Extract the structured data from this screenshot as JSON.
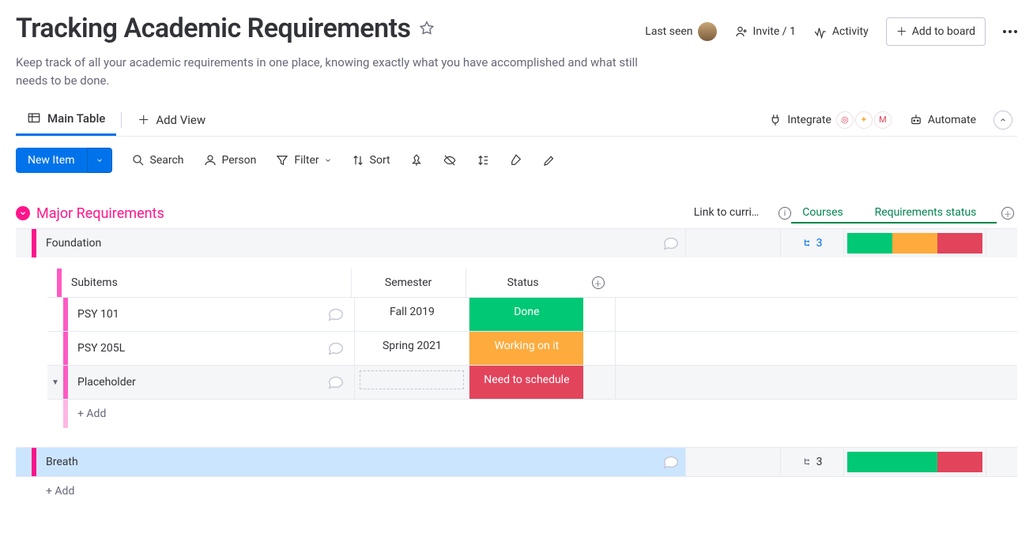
{
  "header": {
    "title": "Tracking Academic Requirements",
    "description": "Keep track of all your academic requirements in one place, knowing exactly what you have accomplished and what still needs to be done.",
    "last_seen": "Last seen",
    "invite": "Invite / 1",
    "activity": "Activity",
    "add_to_board": "Add to board"
  },
  "tabs": {
    "main": "Main Table",
    "add_view": "Add View",
    "integrate": "Integrate",
    "automate": "Automate"
  },
  "toolbar": {
    "new_item": "New Item",
    "search": "Search",
    "person": "Person",
    "filter": "Filter",
    "sort": "Sort"
  },
  "group": {
    "title": "Major Requirements",
    "cols": {
      "link": "Link to curri…",
      "courses": "Courses",
      "status": "Requirements status"
    },
    "rows": {
      "0": {
        "name": "Foundation",
        "courses": "3"
      },
      "1": {
        "name": "Breath",
        "courses": "3"
      }
    },
    "add": "+ Add"
  },
  "sub": {
    "header": {
      "name": "Subitems",
      "semester": "Semester",
      "status": "Status"
    },
    "rows": {
      "0": {
        "name": "PSY 101",
        "semester": "Fall 2019",
        "status": "Done"
      },
      "1": {
        "name": "PSY 205L",
        "semester": "Spring 2021",
        "status": "Working on it"
      },
      "2": {
        "name": "Placeholder",
        "semester": "",
        "status": "Need to schedule"
      }
    },
    "add": "+ Add"
  },
  "colors": {
    "done": "#00c875",
    "work": "#fdab3d",
    "need": "#e2445c",
    "accent": "#ff158a",
    "primary": "#0073ea"
  }
}
